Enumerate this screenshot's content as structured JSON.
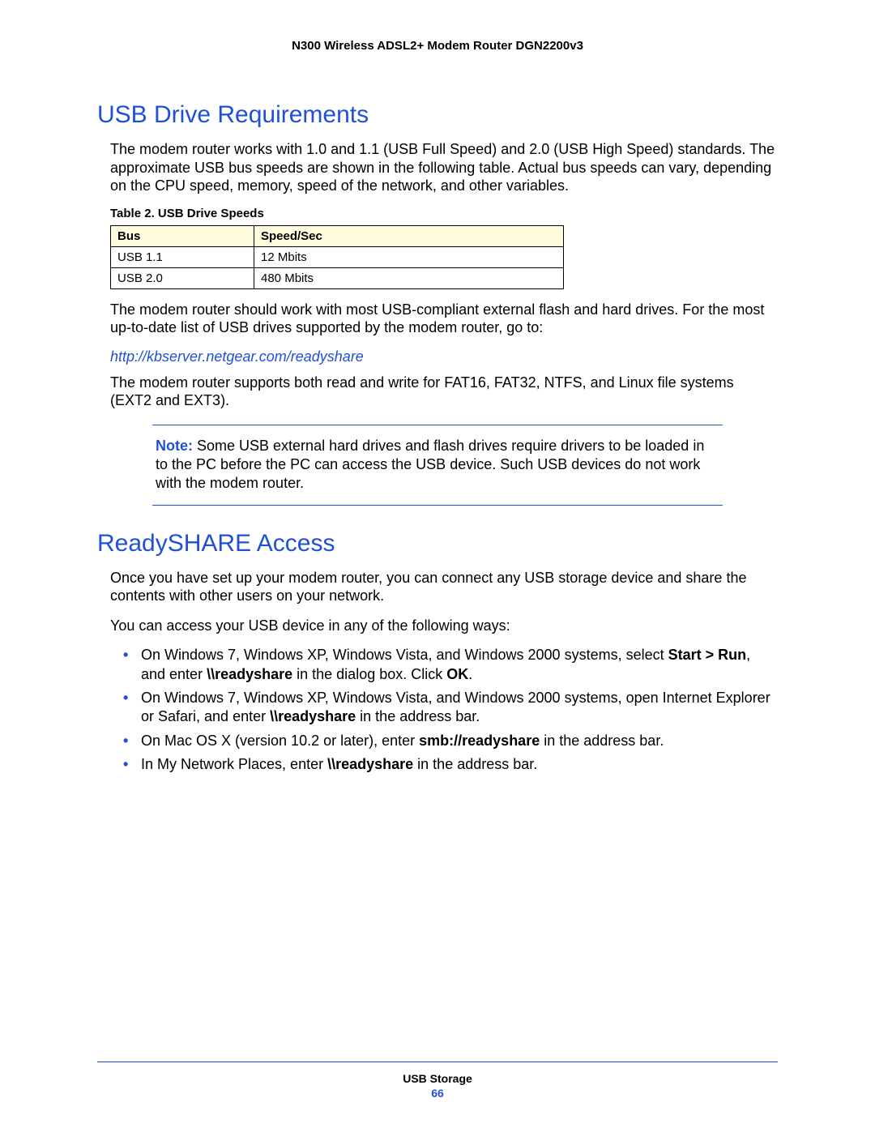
{
  "header": {
    "title": "N300 Wireless ADSL2+ Modem Router DGN2200v3"
  },
  "section1": {
    "heading": "USB Drive Requirements",
    "p1": "The modem router works with 1.0 and 1.1 (USB Full Speed) and 2.0 (USB High Speed) standards. The approximate USB bus speeds are shown in the following table. Actual bus speeds can vary, depending on the CPU speed, memory, speed of the network, and other variables.",
    "table_caption": "Table 2.  USB Drive Speeds",
    "table": {
      "headers": {
        "bus": "Bus",
        "speed": "Speed/Sec"
      },
      "rows": [
        {
          "bus": "USB 1.1",
          "speed": "12 Mbits"
        },
        {
          "bus": "USB 2.0",
          "speed": "480 Mbits"
        }
      ]
    },
    "p2": "The modem router should work with most USB-compliant external flash and hard drives. For the most up-to-date list of USB drives supported by the modem router, go to:",
    "link": "http://kbserver.netgear.com/readyshare",
    "p3": "The modem router supports both read and write for FAT16, FAT32, NTFS, and Linux file systems (EXT2 and EXT3).",
    "note_label": "Note:",
    "note_text": "  Some USB external hard drives and flash drives require drivers to be loaded in to the PC before the PC can access the USB device. Such USB devices do not work with the modem router."
  },
  "section2": {
    "heading": "ReadySHARE Access",
    "p1": "Once you have set up your modem router, you can connect any USB storage device and share the contents with other users on your network.",
    "p2": "You can access your USB device in any of the following ways:",
    "bullets": [
      {
        "pre": "On Windows 7, Windows XP, Windows Vista, and Windows 2000 systems, select ",
        "b1": "Start > Run",
        "mid": ", and enter ",
        "b2": "\\\\readyshare",
        "post": " in the dialog box. Click ",
        "b3": "OK",
        "end": "."
      },
      {
        "pre": "On Windows 7, Windows XP, Windows Vista, and Windows 2000 systems, open Internet Explorer or Safari, and enter ",
        "b1": "\\\\readyshare",
        "post": " in the address bar."
      },
      {
        "pre": "On Mac OS X (version 10.2 or later), enter ",
        "b1": "smb://readyshare",
        "post": " in the address bar."
      },
      {
        "pre": "In My Network Places, enter ",
        "b1": "\\\\readyshare",
        "post": " in the address bar."
      }
    ]
  },
  "footer": {
    "title": "USB Storage",
    "page": "66"
  }
}
